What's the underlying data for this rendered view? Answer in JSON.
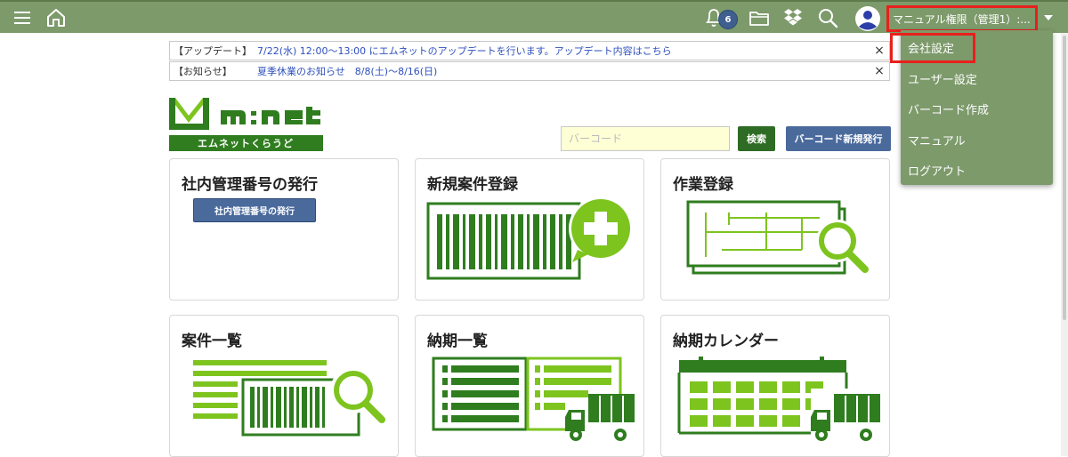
{
  "header": {
    "notification_count": "6",
    "user_name": "マニュアル権限（管理1）:...",
    "icons": [
      "menu-icon",
      "home-icon",
      "bell-icon",
      "folder-icon",
      "dropbox-icon",
      "search-icon",
      "avatar-icon",
      "caret-down-icon"
    ]
  },
  "notices": [
    {
      "tag": "【アップデート】",
      "text": "7/22(水) 12:00～13:00 にエムネットのアップデートを行います。アップデート内容はこちら",
      "close": "×"
    },
    {
      "tag": "【お知らせ】",
      "text": "夏季休業のお知らせ　8/8(土)～8/16(日)",
      "close": "×"
    }
  ],
  "logo": {
    "wordmark": "M:net",
    "tagline": "エムネットくらうど"
  },
  "search": {
    "placeholder": "バーコード",
    "search_label": "検索",
    "new_barcode_label": "バーコード新規発行"
  },
  "cards": [
    {
      "title": "社内管理番号の発行",
      "button": "社内管理番号の発行"
    },
    {
      "title": "新規案件登録"
    },
    {
      "title": "作業登録"
    },
    {
      "title": "案件一覧"
    },
    {
      "title": "納期一覧"
    },
    {
      "title": "納期カレンダー"
    }
  ],
  "dropdown": {
    "items": [
      "会社設定",
      "ユーザー設定",
      "バーコード作成",
      "マニュアル",
      "ログアウト"
    ]
  },
  "colors": {
    "header_bg": "#7d9a6b",
    "brand_green": "#2f7d1f",
    "light_green": "#7dc41f",
    "button_blue": "#4a6a9c",
    "highlight_red": "#e8201c"
  }
}
